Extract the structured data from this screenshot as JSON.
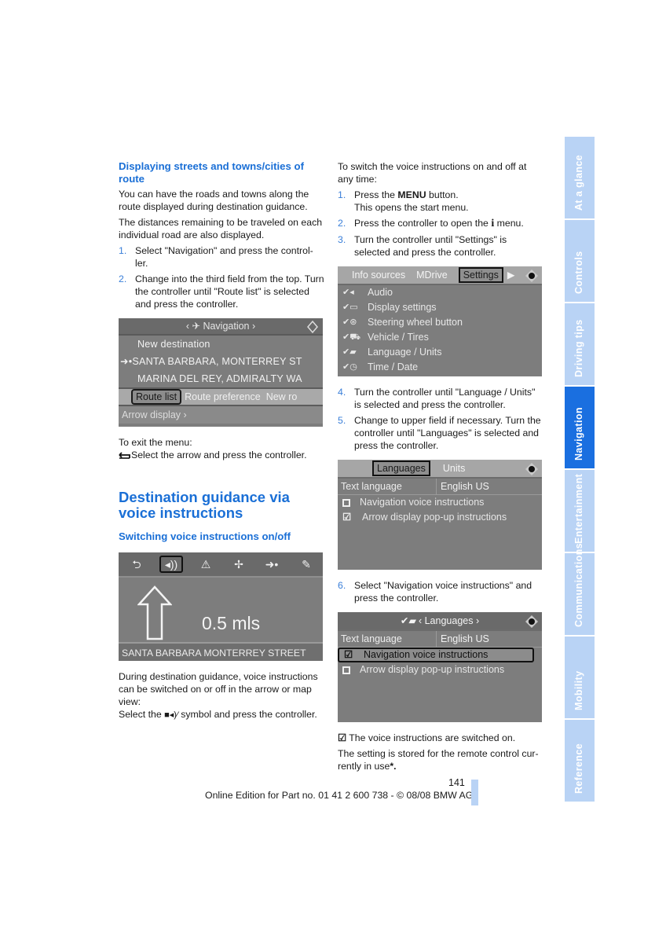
{
  "left": {
    "h_streets": "Displaying streets and towns/cities of route",
    "p1": "You can have the roads and towns along the route displayed during destination guidance.",
    "p2": "The distances remaining to be traveled on each individual road are also displayed.",
    "steps": [
      {
        "num": "1.",
        "text": "Select \"Navigation\" and press the control-ler."
      },
      {
        "num": "2.",
        "text": "Change into the third field from the top. Turn the controller until \"Route list\" is selected and press the controller."
      }
    ],
    "nav_screen": {
      "title": "‹ ✈ Navigation ›",
      "rows": [
        "New destination",
        "SANTA BARBARA, MONTERREY ST",
        "MARINA DEL REY, ADMIRALTY WA"
      ],
      "current_marker": "➜•",
      "tabs": [
        "Route list",
        "Route preference",
        "New ro"
      ],
      "footer": "Arrow display ›"
    },
    "exit_label": "To exit the menu:",
    "exit_text": "Select the arrow and press the controller.",
    "h_voice": "Destination guidance via voice instructions",
    "h_switch": "Switching voice instructions on/off",
    "arrow_screen": {
      "icons": [
        "back-arrow",
        "speaker-voice",
        "warning",
        "traffic",
        "route-dot",
        "tool"
      ],
      "distance": "0.5 mls",
      "street": "SANTA BARBARA MONTERREY STREET"
    },
    "p_during": "During destination guidance, voice instructions can be switched on or off in the arrow or map view:",
    "p_select_pre": "Select the",
    "p_select_post": "symbol and press the controller."
  },
  "right": {
    "intro": "To switch the voice instructions on and off at any time:",
    "step1_num": "1.",
    "step1_pre": "Press the",
    "step1_menu": "MENU",
    "step1_post": "button.",
    "step1_line2": "This opens the start menu.",
    "step2_num": "2.",
    "step2_pre": "Press the controller to open the",
    "step2_icon": "i",
    "step2_post": "menu.",
    "step3_num": "3.",
    "step3_text": "Turn the controller until \"Settings\" is selected and press the controller.",
    "settings_screen": {
      "tabs": [
        "Info sources",
        "MDrive",
        "Settings"
      ],
      "items": [
        "Audio",
        "Display settings",
        "Steering wheel button",
        "Vehicle / Tires",
        "Language / Units",
        "Time / Date"
      ]
    },
    "step4_num": "4.",
    "step4_text": "Turn the controller until \"Language / Units\" is selected and press the controller.",
    "step5_num": "5.",
    "step5_text": "Change to upper field if necessary. Turn the controller until \"Languages\" is selected and press the controller.",
    "lang_screen1": {
      "tabs": [
        "Languages",
        "Units"
      ],
      "text_language_label": "Text language",
      "text_language_value": "English US",
      "options": [
        {
          "label": "Navigation voice instructions",
          "checked": false
        },
        {
          "label": "Arrow display pop-up instructions",
          "checked": true
        }
      ]
    },
    "step6_num": "6.",
    "step6_text": "Select \"Navigation voice instructions\" and press the controller.",
    "lang_screen2": {
      "title": "‹ Languages ›",
      "text_language_label": "Text language",
      "text_language_value": "English US",
      "options": [
        {
          "label": "Navigation voice instructions",
          "checked": true
        },
        {
          "label": "Arrow display pop-up instructions",
          "checked": false
        }
      ]
    },
    "result": "The voice instructions are switched on.",
    "stored": "The setting is stored for the remote control cur-rently in use",
    "stored_star": "*."
  },
  "side_tabs": [
    {
      "label": "At a glance",
      "active": false
    },
    {
      "label": "Controls",
      "active": false
    },
    {
      "label": "Driving tips",
      "active": false
    },
    {
      "label": "Navigation",
      "active": true
    },
    {
      "label": "Entertainment",
      "active": false
    },
    {
      "label": "Communications",
      "active": false
    },
    {
      "label": "Mobility",
      "active": false
    },
    {
      "label": "Reference",
      "active": false
    }
  ],
  "footer": {
    "page_number": "141",
    "edition": "Online Edition for Part no. 01 41 2 600 738 - © 08/08 BMW AG"
  },
  "colors": {
    "accent": "#1a6fd6",
    "tab_inactive": "#b9d3f5",
    "tab_active": "#1a6fe0",
    "screen_gray": "#7d7d7d"
  }
}
